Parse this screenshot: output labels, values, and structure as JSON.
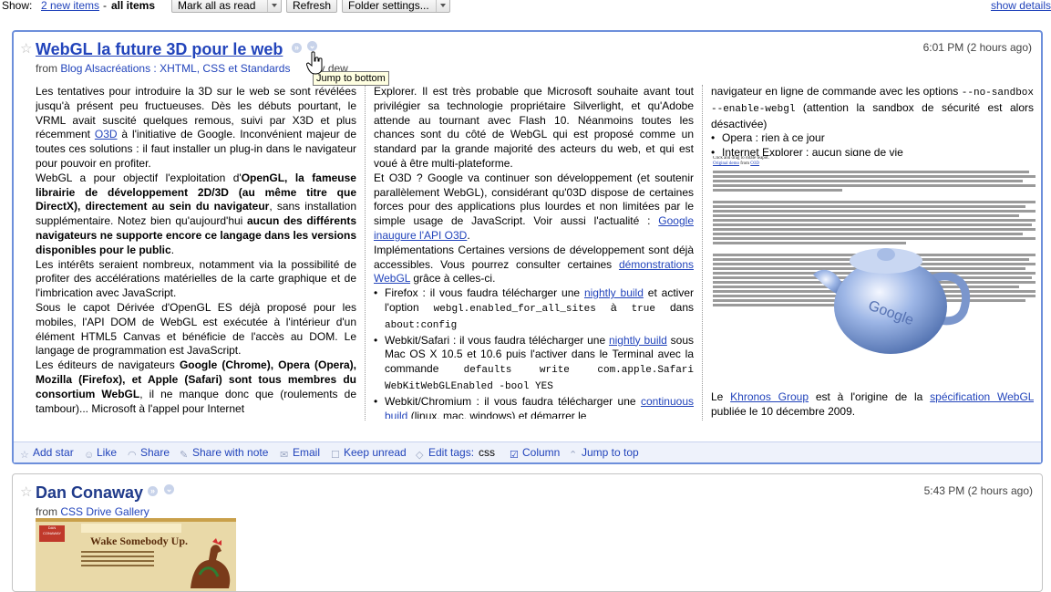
{
  "toolbar": {
    "show_label": "Show:",
    "new_items": "2 new items",
    "separator": "-",
    "all_items": "all items",
    "mark_all_read": "Mark all as read",
    "refresh": "Refresh",
    "folder_settings": "Folder settings...",
    "show_details": "show details"
  },
  "entry1": {
    "title": "WebGL la future 3D pour le web",
    "time": "6:01 PM (2 hours ago)",
    "from_label": "from",
    "source": "Blog Alsacréations : XHTML, CSS et Standards",
    "by_text": "by dew",
    "tooltip": "Jump to bottom",
    "col1": {
      "p1": "Les tentatives pour introduire la 3D sur le web se sont révélées jusqu'à présent peu fructueuses. Dès les débuts pourtant, le VRML avait suscité quelques remous, suivi par X3D et plus récemment ",
      "p1_link": "O3D",
      "p1_end": " à l'initiative de Google. Inconvénient majeur de toutes ces solutions : il faut installer un plug-in dans le navigateur pour pouvoir en profiter.",
      "p2_a": "WebGL a pour objectif l'exploitation d'",
      "p2_b": "OpenGL, la fameuse librairie de développement 2D/3D (au même titre que DirectX), directement au sein du navigateur",
      "p2_c": ", sans installation supplémentaire. Notez bien qu'aujourd'hui ",
      "p2_d": "aucun des différents navigateurs ne supporte encore ce langage dans les versions disponibles pour le public",
      "p2_e": ".",
      "p3": "Les intérêts seraient nombreux, notamment via la possibilité de profiter des accélérations matérielles de la carte graphique et de l'imbrication avec JavaScript.",
      "p4": "Sous le capot Dérivée d'OpenGL ES déjà proposé pour les mobiles, l'API DOM de WebGL est exécutée à l'intérieur d'un élément HTML5 Canvas et bénéficie de l'accès au DOM. Le langage de programmation est JavaScript.",
      "p5_a": "Les éditeurs de navigateurs ",
      "p5_b": "Google (Chrome), Opera (Opera), Mozilla (Firefox), et Apple (Safari) sont tous membres du consortium WebGL",
      "p5_c": ", il ne manque donc que (roulements de tambour)... Microsoft à l'appel pour Internet"
    },
    "col2": {
      "p1": "Explorer. Il est très probable que Microsoft souhaite avant tout privilégier sa technologie propriétaire Silverlight, et qu'Adobe attende au tournant avec Flash 10. Néanmoins toutes les chances sont du côté de WebGL qui est proposé comme un standard par la grande majorité des acteurs du web, et qui est voué à être multi-plateforme.",
      "p2": "Et O3D ? Google va continuer son développement (et soutenir parallèlement WebGL), considérant qu'03D dispose de certaines forces pour des applications plus lourdes et non limitées par le simple usage de JavaScript. Voir aussi l'actualité : ",
      "p2_link": "Google inaugure l'API O3D",
      "p2_end": ".",
      "p3": "Implémentations Certaines versions de développement sont déjà accessibles. Vous pourrez consulter certaines ",
      "p3_link": "démonstrations WebGL",
      "p3_end": " grâce à celles-ci.",
      "li1_a": "Firefox : il vous faudra télécharger une ",
      "li1_link": "nightly build",
      "li1_b": " et activer l'option ",
      "li1_code1": "webgl.enabled_for_all_sites",
      "li1_c": " à ",
      "li1_code2": "true",
      "li1_d": " dans ",
      "li1_code3": "about:config",
      "li2_a": "Webkit/Safari : il vous faudra télécharger une ",
      "li2_link": "nightly build",
      "li2_b": " sous Mac OS X 10.5 et 10.6 puis l'activer dans le Terminal avec la commande ",
      "li2_code": "defaults write com.apple.Safari WebKitWebGLEnabled -bool YES",
      "li3_a": "Webkit/Chromium : il vous faudra télécharger une ",
      "li3_link": "continuous build",
      "li3_b": " (linux, mac, windows) et démarrer le"
    },
    "col3": {
      "p1_a": "navigateur en ligne de commande avec les options ",
      "p1_code": "--no-sandbox --enable-webgl",
      "p1_b": " (attention la sandbox de sécurité est alors désactivée)",
      "li1": "Opera : rien à ce jour",
      "li2": "Internet Explorer : aucun signe de vie",
      "demo_line1": "Click and drag to rotate teapot.",
      "demo_line2_link": "Original demo",
      "demo_line2_mid": " from ",
      "demo_line2_link2": "O3D",
      "p2_a": "Le ",
      "p2_link1": "Khronos Group",
      "p2_b": " est à l'origine de la ",
      "p2_link2": "spécification WebGL",
      "p2_c": " publiée le 10 décembre 2009."
    },
    "actions": {
      "add_star": "Add star",
      "like": "Like",
      "share": "Share",
      "share_note": "Share with note",
      "email": "Email",
      "keep_unread": "Keep unread",
      "edit_tags": "Edit tags:",
      "tag": "css",
      "column": "Column",
      "jump_top": "Jump to top"
    }
  },
  "entry2": {
    "title": "Dan Conaway",
    "time": "5:43 PM (2 hours ago)",
    "from_label": "from",
    "source": "CSS Drive Gallery",
    "thumb_heading": "Wake Somebody Up.",
    "thumb_logo": "DAN CONAWAY"
  },
  "colors": {
    "link": "#2244bb",
    "entry_border": "#6d8fdb",
    "action_bar": "#eef2fb"
  }
}
